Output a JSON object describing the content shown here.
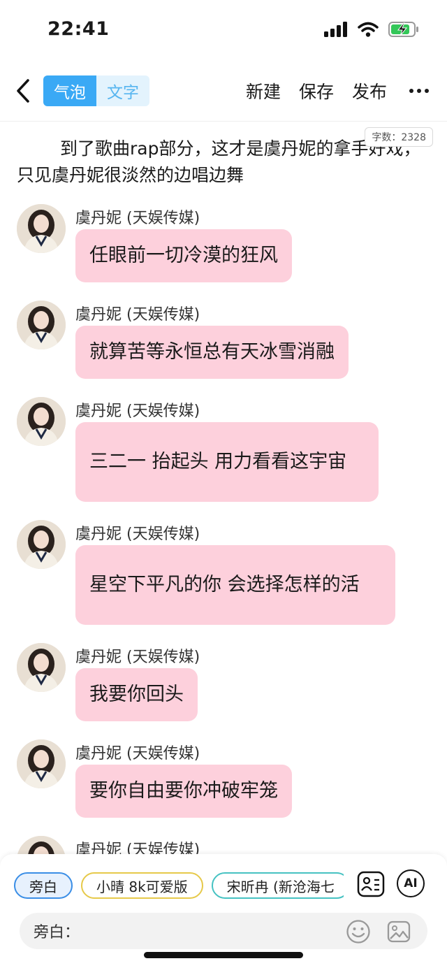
{
  "status_bar": {
    "time": "22:41"
  },
  "nav": {
    "mode_bubble": "气泡",
    "mode_text": "文字",
    "actions": [
      "新建",
      "保存",
      "发布"
    ]
  },
  "editor": {
    "word_count": "字数：2328",
    "narration": "到了歌曲rap部分，这才是虞丹妮的拿手好戏，只见虞丹妮很淡然的边唱边舞",
    "messages": [
      {
        "speaker": "虞丹妮 (天娱传媒)",
        "text": "任眼前一切冷漠的狂风"
      },
      {
        "speaker": "虞丹妮 (天娱传媒)",
        "text": "就算苦等永恒总有天冰雪消融"
      },
      {
        "speaker": "虞丹妮 (天娱传媒)",
        "text": "三二一 抬起头 用力看看这宇宙"
      },
      {
        "speaker": "虞丹妮 (天娱传媒)",
        "text": "星空下平凡的你 会选择怎样的活"
      },
      {
        "speaker": "虞丹妮 (天娱传媒)",
        "text": "我要你回头"
      },
      {
        "speaker": "虞丹妮 (天娱传媒)",
        "text": "要你自由要你冲破牢笼"
      },
      {
        "speaker": "虞丹妮 (天娱传媒)",
        "text": ""
      }
    ]
  },
  "bottom": {
    "chips": [
      "旁白",
      "小晴 8k可爱版",
      "宋昕冉 (新沧海七"
    ],
    "ai_label": "AI",
    "input_prefix": "旁白：",
    "input_value": ""
  },
  "colors": {
    "accent_blue": "#3aa9f5",
    "bubble_pink": "#fdd0dc",
    "battery_green": "#34c759"
  }
}
